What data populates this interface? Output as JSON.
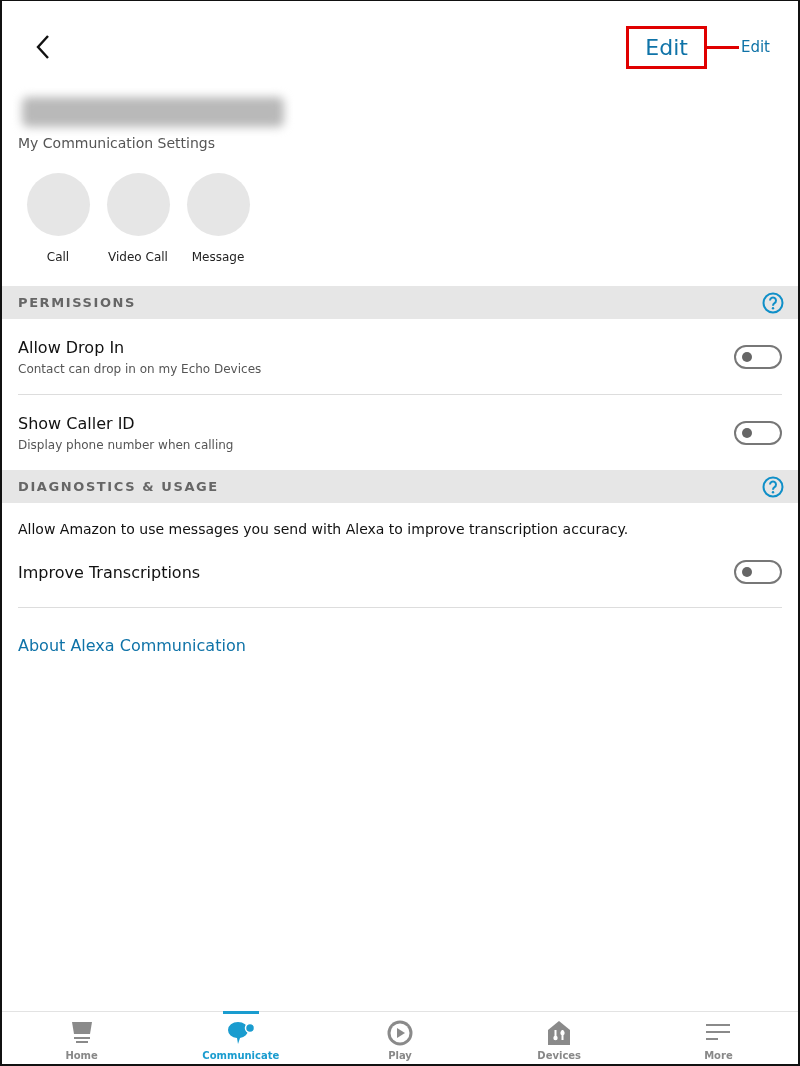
{
  "header": {
    "edit_button": "Edit",
    "callout_label": "Edit",
    "subtitle": "My Communication Settings"
  },
  "actions": [
    {
      "label": "Call"
    },
    {
      "label": "Video Call"
    },
    {
      "label": "Message"
    }
  ],
  "sections": [
    {
      "title": "PERMISSIONS",
      "rows": [
        {
          "title": "Allow Drop In",
          "subtitle": "Contact can drop in on my Echo Devices",
          "on": false
        },
        {
          "title": "Show Caller ID",
          "subtitle": "Display phone number when calling",
          "on": false
        }
      ]
    },
    {
      "title": "DIAGNOSTICS & USAGE",
      "description": "Allow Amazon to use messages you send with Alexa to improve transcription accuracy.",
      "rows": [
        {
          "title": "Improve Transcriptions",
          "on": false
        }
      ]
    }
  ],
  "link": "About Alexa Communication",
  "nav": [
    {
      "label": "Home",
      "selected": false
    },
    {
      "label": "Communicate",
      "selected": true
    },
    {
      "label": "Play",
      "selected": false
    },
    {
      "label": "Devices",
      "selected": false
    },
    {
      "label": "More",
      "selected": false
    }
  ]
}
